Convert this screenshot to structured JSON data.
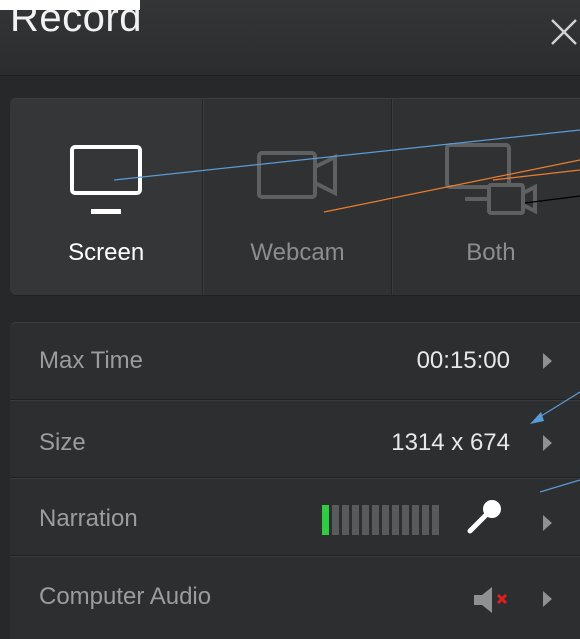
{
  "window": {
    "title": "Record",
    "close_icon": "close-x-icon"
  },
  "modes": [
    {
      "label": "Screen",
      "icon": "monitor-icon",
      "active": true
    },
    {
      "label": "Webcam",
      "icon": "webcam-icon",
      "active": false
    },
    {
      "label": "Both",
      "icon": "monitor-webcam-icon",
      "active": false
    }
  ],
  "settings": {
    "max_time": {
      "label": "Max Time",
      "value": "00:15:00"
    },
    "size": {
      "label": "Size",
      "value": "1314 x 674"
    },
    "narration": {
      "label": "Narration",
      "mic_icon": "microphone-icon",
      "level_fraction": 0.1
    },
    "computer_audio": {
      "label": "Computer Audio",
      "icon": "speaker-muted-icon",
      "muted": true
    }
  },
  "colors": {
    "panel_bg": "#262829",
    "active_text": "#ffffff",
    "inactive_text": "#8b8d8f",
    "meter_on": "#2ecc40",
    "mute_x": "#e02020",
    "annotation_blue": "#5b9bd5",
    "annotation_orange": "#ed7d31"
  }
}
